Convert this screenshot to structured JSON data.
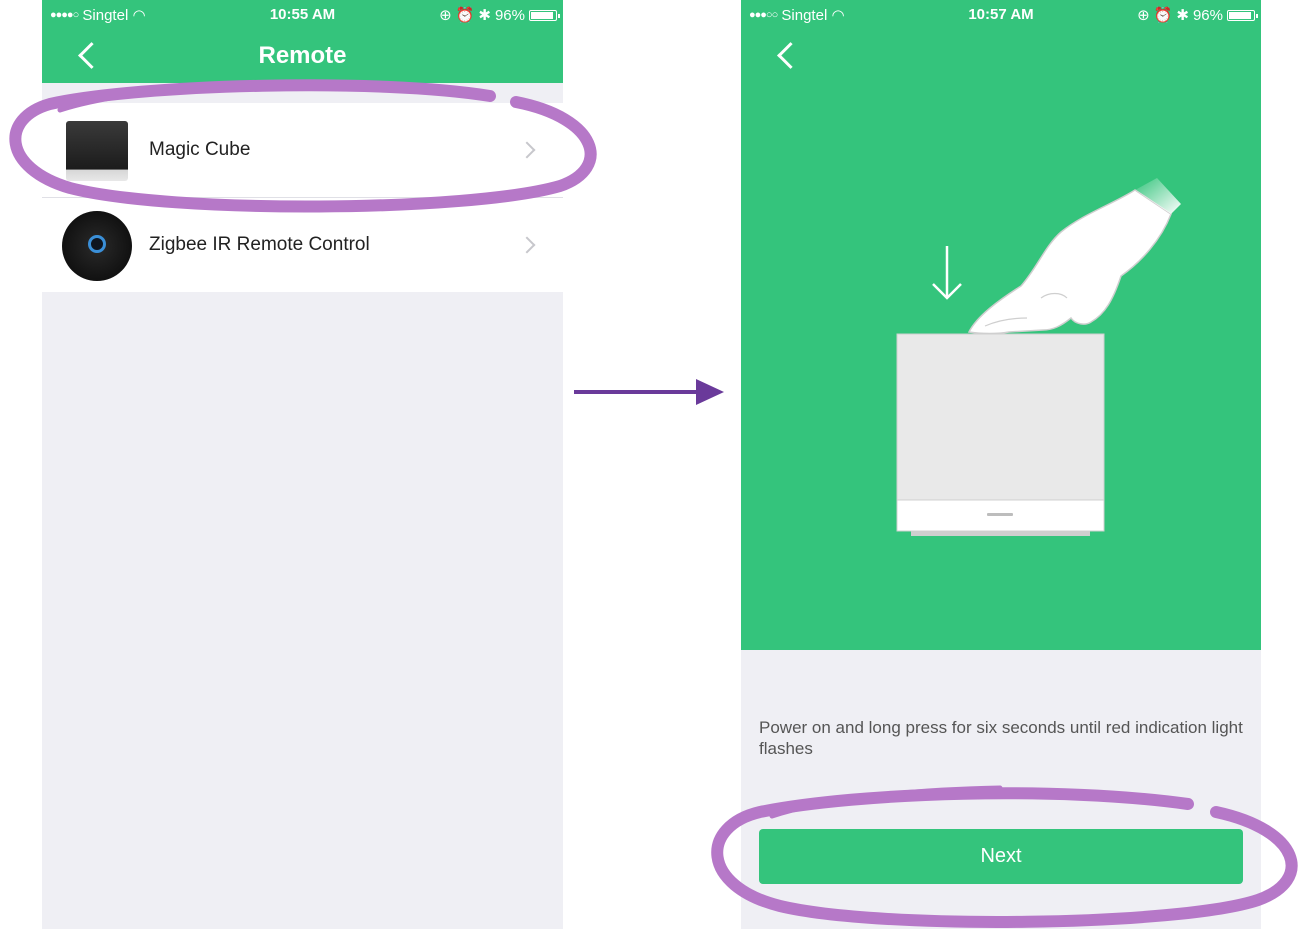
{
  "left_screen": {
    "status": {
      "carrier": "Singtel",
      "signal_dots": "●●●●○",
      "time": "10:55 AM",
      "battery": "96%"
    },
    "nav": {
      "title": "Remote"
    },
    "items": [
      {
        "label": "Magic Cube"
      },
      {
        "label": "Zigbee IR Remote Control"
      }
    ]
  },
  "right_screen": {
    "status": {
      "carrier": "Singtel",
      "signal_dots": "●●●○○",
      "time": "10:57 AM",
      "battery": "96%"
    },
    "instruction": "Power on and long press for six seconds until red indication light flashes",
    "next_label": "Next"
  },
  "colors": {
    "accent": "#34c47c",
    "annotation": "#b678c8",
    "arrow": "#6a3a9a"
  }
}
